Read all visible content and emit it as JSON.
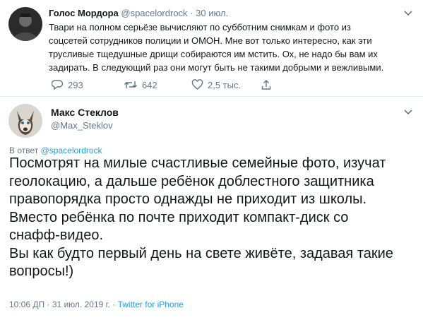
{
  "tweet1": {
    "name": "Голос Мордора",
    "handle": "@spacelordrock",
    "separator": "·",
    "date": "30 июл.",
    "lines": [
      "Твари на полном серьёзе вычисляют по субботним снимкам и фото из",
      "соцсетей сотрудников полиции и ОМОН. Мне вот только интересно, как эти",
      "трусливые тщедушные дрищи собираются им мстить. Ох, не надо бы вам их",
      "задирать. В следующий раз они могут быть не такими добрыми и вежливыми."
    ],
    "replies": "293",
    "retweets": "642",
    "likes": "2,5 тыс."
  },
  "tweet2": {
    "name": "Макс Стеклов",
    "handle": "@Max_Steklov",
    "replying_prefix": "В ответ",
    "replying_to": "@spacelordrock",
    "lines": [
      "Посмотрят на милые счастливые семейные фото, изучат",
      "геолокацию, а дальше ребёнок доблестного защитника",
      "правопорядка просто однажды не приходит из школы.",
      "Вместо ребёнка по почте приходит компакт-диск со",
      "снафф-видео.",
      "Вы как будто первый день на свете живёте, задавая такие",
      "вопросы!)"
    ],
    "time": "10:06 ДП",
    "separator": "·",
    "date": "31 июл. 2019 г.",
    "source": "Twitter for iPhone"
  },
  "colors": {
    "text": "#14171a",
    "muted": "#657786",
    "link": "#1da1f2",
    "divider": "#e6ecf0"
  },
  "icons": [
    "chevron-down-icon",
    "reply-icon",
    "retweet-icon",
    "like-icon",
    "share-icon"
  ]
}
